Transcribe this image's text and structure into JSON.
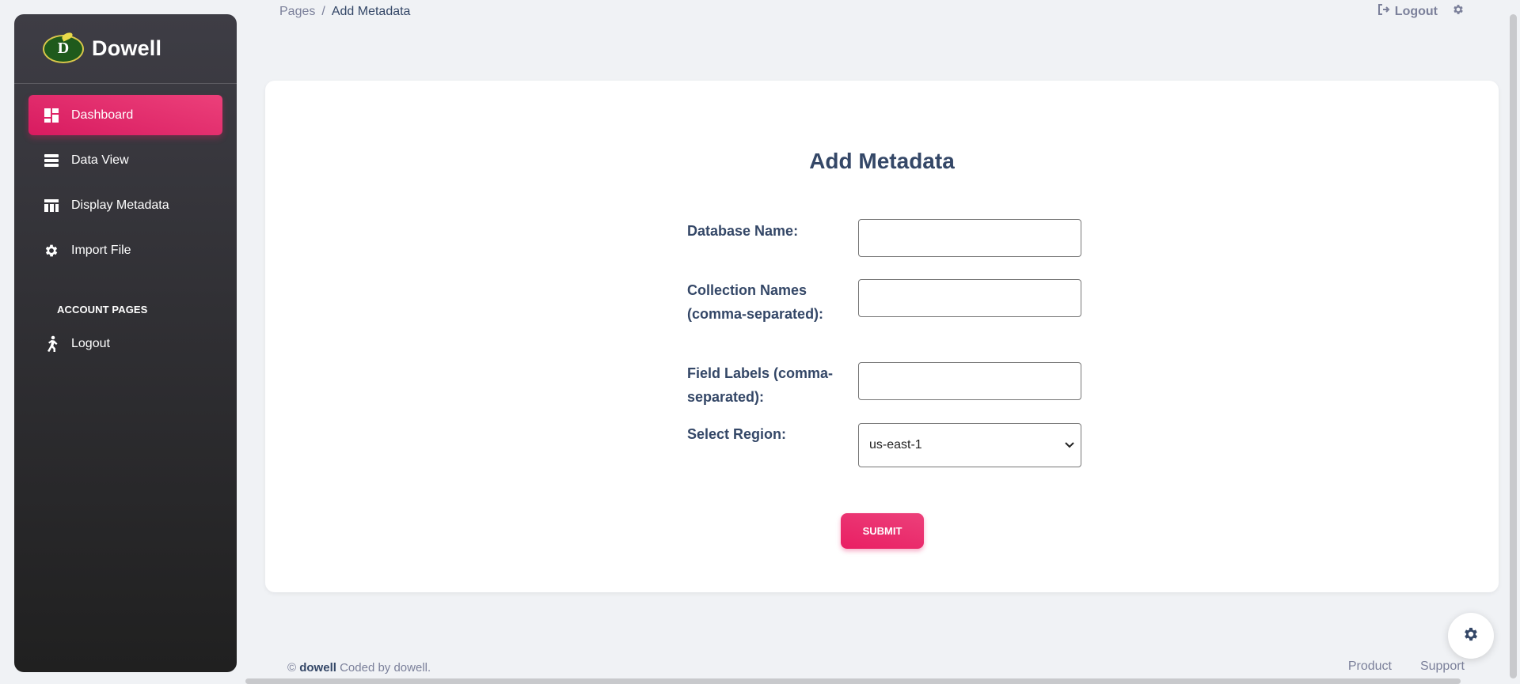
{
  "brand": {
    "name": "Dowell",
    "logo_text": "D"
  },
  "sidebar": {
    "items": [
      {
        "label": "Dashboard",
        "icon": "dashboard-icon"
      },
      {
        "label": "Data View",
        "icon": "table-rows-icon"
      },
      {
        "label": "Display Metadata",
        "icon": "table-chart-icon"
      },
      {
        "label": "Import File",
        "icon": "gear-icon"
      }
    ],
    "section_title": "ACCOUNT PAGES",
    "account_items": [
      {
        "label": "Logout",
        "icon": "running-person-icon"
      }
    ]
  },
  "header": {
    "breadcrumb_root": "Pages",
    "breadcrumb_sep": "/",
    "breadcrumb_current": "Add Metadata",
    "logout_label": "Logout"
  },
  "form": {
    "title": "Add Metadata",
    "database_label": "Database Name:",
    "database_value": "",
    "collection_label": "Collection Names (comma-separated):",
    "collection_value": "",
    "fields_label": "Field Labels (comma-separated):",
    "fields_value": "",
    "region_label": "Select Region:",
    "region_value": "us-east-1",
    "submit_label": "SUBMIT"
  },
  "footer": {
    "copyright_symbol": "©",
    "company": "dowell",
    "coded_by": "Coded by dowell.",
    "links": [
      "Product",
      "Support"
    ]
  },
  "colors": {
    "accent": "#e91e63",
    "sidebar_top": "#3e3d45",
    "sidebar_bottom": "#202020",
    "text_primary": "#344767",
    "text_muted": "#7b809a"
  }
}
